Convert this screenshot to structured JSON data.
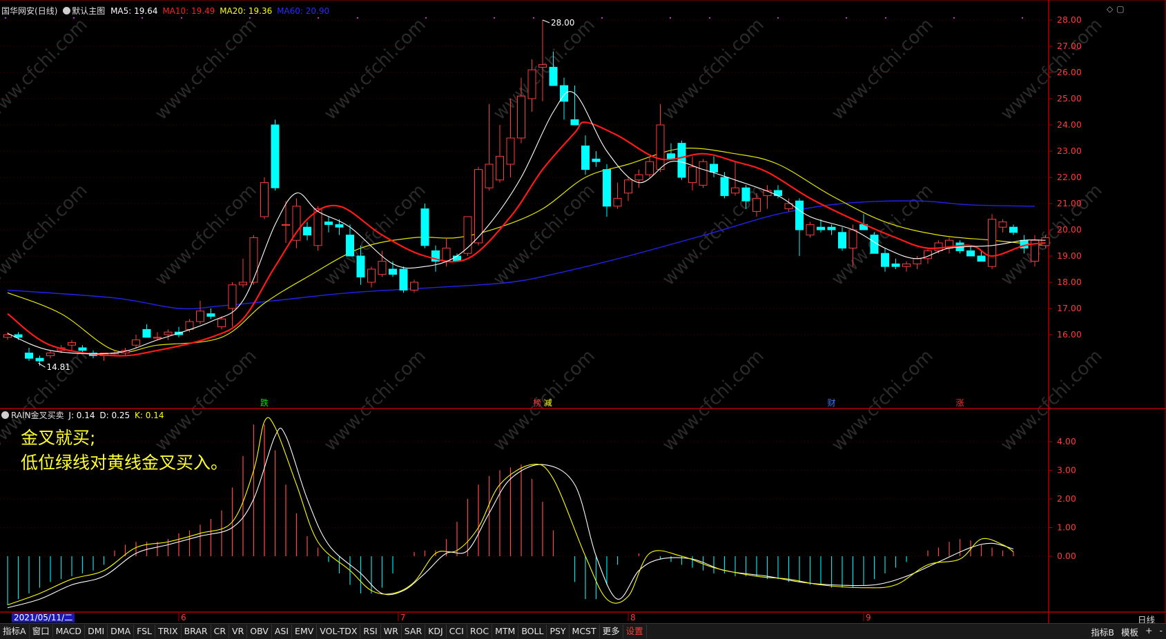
{
  "header": {
    "stock_name": "国华网安",
    "period": "(日线)",
    "main_chart_name": "默认主图",
    "ma5": "MA5: 19.64",
    "ma10": "MA10: 19.49",
    "ma20": "MA20: 19.36",
    "ma60": "MA60: 20.90"
  },
  "indicator_header": {
    "name": "RAIN金叉买卖",
    "j": "J: 0.14",
    "d": "D: 0.25",
    "k": "K: 0.14"
  },
  "annotation": {
    "line1": "金叉就买;",
    "line2": "低位绿线对黄线金叉买入。"
  },
  "price_axis": [
    "28.00",
    "27.00",
    "26.00",
    "25.00",
    "24.00",
    "23.00",
    "22.00",
    "21.00",
    "20.00",
    "19.00",
    "18.00",
    "17.00",
    "16.00"
  ],
  "indicator_axis": [
    "4.00",
    "3.00",
    "2.00",
    "1.00",
    "0.00"
  ],
  "markers": {
    "high": "28.00",
    "low": "14.81"
  },
  "event_labels": [
    {
      "text": "跌",
      "color": "#00e000"
    },
    {
      "text": "榜",
      "color": "#ff3030"
    },
    {
      "text": "减",
      "color": "#ffff00"
    },
    {
      "text": "财",
      "color": "#3a7aff"
    },
    {
      "text": "涨",
      "color": "#ff3030"
    }
  ],
  "time_axis": {
    "current_date": "2021/05/11/二",
    "months": [
      "6",
      "7",
      "8",
      "9"
    ],
    "period_label": "日线"
  },
  "colors": {
    "up": "#ff3c3c",
    "down": "#00ffff",
    "ma5": "#ffffff",
    "ma10": "#ff1a1a",
    "ma20": "#e6e600",
    "ma60": "#2222ee",
    "axis": "#b00000",
    "annotation": "#ffff2e"
  },
  "tabs": [
    "指标A",
    "窗口",
    "MACD",
    "DMI",
    "DMA",
    "FSL",
    "TRIX",
    "BRAR",
    "CR",
    "VR",
    "OBV",
    "ASI",
    "EMV",
    "VOL-TDX",
    "RSI",
    "WR",
    "SAR",
    "KDJ",
    "CCI",
    "ROC",
    "MTM",
    "BOLL",
    "PSY",
    "MCST",
    "更多",
    "设置"
  ],
  "tabs_active": "设置",
  "tabs_right": [
    "指标B",
    "模板",
    "+",
    "-"
  ],
  "watermark": "www.cfchi.com",
  "chart_data": {
    "type": "candlestick",
    "ylim": [
      15,
      28.5
    ],
    "candles_ohlc": [
      [
        15.9,
        16.1,
        15.8,
        16.0
      ],
      [
        16.0,
        16.1,
        15.8,
        15.9
      ],
      [
        15.3,
        15.5,
        15.0,
        15.1
      ],
      [
        15.1,
        15.2,
        14.81,
        15.0
      ],
      [
        15.2,
        15.4,
        15.1,
        15.3
      ],
      [
        15.4,
        15.6,
        15.3,
        15.5
      ],
      [
        15.6,
        15.8,
        15.4,
        15.7
      ],
      [
        15.5,
        15.6,
        15.3,
        15.4
      ],
      [
        15.3,
        15.4,
        15.1,
        15.2
      ],
      [
        15.2,
        15.3,
        15.0,
        15.3
      ],
      [
        15.3,
        15.4,
        15.2,
        15.3
      ],
      [
        15.3,
        15.5,
        15.2,
        15.4
      ],
      [
        15.6,
        16.0,
        15.5,
        15.8
      ],
      [
        16.2,
        16.4,
        16.0,
        15.9
      ],
      [
        15.9,
        16.1,
        15.8,
        15.9
      ],
      [
        16.0,
        16.2,
        15.8,
        16.1
      ],
      [
        16.1,
        16.3,
        15.9,
        16.0
      ],
      [
        16.2,
        16.6,
        16.1,
        16.5
      ],
      [
        16.5,
        17.3,
        16.4,
        16.9
      ],
      [
        16.8,
        17.0,
        16.6,
        16.7
      ],
      [
        16.3,
        16.7,
        16.2,
        16.6
      ],
      [
        17.0,
        18.0,
        16.3,
        17.9
      ],
      [
        17.9,
        18.9,
        17.8,
        18.0
      ],
      [
        18.0,
        19.8,
        17.9,
        19.7
      ],
      [
        20.5,
        22.0,
        20.4,
        21.8
      ],
      [
        24.0,
        24.2,
        21.5,
        21.6
      ],
      [
        20.2,
        21.1,
        19.5,
        20.2
      ],
      [
        19.6,
        21.2,
        19.3,
        20.9
      ],
      [
        20.1,
        20.3,
        19.6,
        19.8
      ],
      [
        19.4,
        20.9,
        19.2,
        20.8
      ],
      [
        20.3,
        20.5,
        19.9,
        20.2
      ],
      [
        20.2,
        20.4,
        19.8,
        20.1
      ],
      [
        19.8,
        20.2,
        19.0,
        19.0
      ],
      [
        19.0,
        19.4,
        17.9,
        18.2
      ],
      [
        18.0,
        18.6,
        17.8,
        18.5
      ],
      [
        18.3,
        19.2,
        18.2,
        18.8
      ],
      [
        18.5,
        18.8,
        18.2,
        18.3
      ],
      [
        18.5,
        18.6,
        17.6,
        17.7
      ],
      [
        17.7,
        18.1,
        17.6,
        18.0
      ],
      [
        20.8,
        21.0,
        19.3,
        19.4
      ],
      [
        19.2,
        19.4,
        18.4,
        18.8
      ],
      [
        18.8,
        19.7,
        18.6,
        19.3
      ],
      [
        19.0,
        19.1,
        18.8,
        18.8
      ],
      [
        19.1,
        20.2,
        19.0,
        20.5
      ],
      [
        19.5,
        22.4,
        19.4,
        22.3
      ],
      [
        21.6,
        24.8,
        21.5,
        22.5
      ],
      [
        21.9,
        24.0,
        21.8,
        22.8
      ],
      [
        22.5,
        25.0,
        22.0,
        23.5
      ],
      [
        23.5,
        25.8,
        23.3,
        25.1
      ],
      [
        25.0,
        26.5,
        24.5,
        26.1
      ],
      [
        26.2,
        28.0,
        24.9,
        26.3
      ],
      [
        26.2,
        26.8,
        25.5,
        25.5
      ],
      [
        25.5,
        25.8,
        24.2,
        24.9
      ],
      [
        24.2,
        25.5,
        24.0,
        24.0
      ],
      [
        23.2,
        23.6,
        22.1,
        22.3
      ],
      [
        22.7,
        23.0,
        22.4,
        22.6
      ],
      [
        22.3,
        22.5,
        20.5,
        20.9
      ],
      [
        20.9,
        21.8,
        20.8,
        21.2
      ],
      [
        21.4,
        22.0,
        21.1,
        21.9
      ],
      [
        21.9,
        22.3,
        21.6,
        22.1
      ],
      [
        22.1,
        22.8,
        22.0,
        22.6
      ],
      [
        22.3,
        24.8,
        22.2,
        24.0
      ],
      [
        22.9,
        23.3,
        22.7,
        22.7
      ],
      [
        23.3,
        23.4,
        21.9,
        22.0
      ],
      [
        21.8,
        22.8,
        21.5,
        22.4
      ],
      [
        21.7,
        22.7,
        21.6,
        22.6
      ],
      [
        22.5,
        22.8,
        22.0,
        22.2
      ],
      [
        22.0,
        22.2,
        21.2,
        21.3
      ],
      [
        21.4,
        22.6,
        21.3,
        21.6
      ],
      [
        21.6,
        21.7,
        20.8,
        21.1
      ],
      [
        20.7,
        21.4,
        20.5,
        21.2
      ],
      [
        21.3,
        21.7,
        20.8,
        21.5
      ],
      [
        21.5,
        21.7,
        21.2,
        21.3
      ],
      [
        20.8,
        21.2,
        20.7,
        21.0
      ],
      [
        21.1,
        21.2,
        19.0,
        20.0
      ],
      [
        19.8,
        20.3,
        19.7,
        20.2
      ],
      [
        20.1,
        20.4,
        19.9,
        20.0
      ],
      [
        20.1,
        20.2,
        19.8,
        20.0
      ],
      [
        19.9,
        20.1,
        19.2,
        19.3
      ],
      [
        19.3,
        20.2,
        18.6,
        20.0
      ],
      [
        20.2,
        20.6,
        20.0,
        20.0
      ],
      [
        19.8,
        19.9,
        19.1,
        19.1
      ],
      [
        19.1,
        19.3,
        18.4,
        18.6
      ],
      [
        18.7,
        18.9,
        18.5,
        18.6
      ],
      [
        18.6,
        18.8,
        18.4,
        18.7
      ],
      [
        18.7,
        19.0,
        18.5,
        18.9
      ],
      [
        18.9,
        19.3,
        18.7,
        19.2
      ],
      [
        19.2,
        19.6,
        19.1,
        19.5
      ],
      [
        19.3,
        19.7,
        19.1,
        19.6
      ],
      [
        19.5,
        19.6,
        19.1,
        19.2
      ],
      [
        19.2,
        19.4,
        19.0,
        19.0
      ],
      [
        19.0,
        19.2,
        18.8,
        18.8
      ],
      [
        18.6,
        20.6,
        18.5,
        20.4
      ],
      [
        20.1,
        20.4,
        19.9,
        20.3
      ],
      [
        20.1,
        20.2,
        19.8,
        19.9
      ],
      [
        19.6,
        19.8,
        19.1,
        19.3
      ],
      [
        18.8,
        19.8,
        18.6,
        19.6
      ],
      [
        19.4,
        19.8,
        19.3,
        19.7
      ]
    ],
    "ma5": [
      [
        0,
        16.05
      ],
      [
        4,
        15.4
      ],
      [
        10,
        15.3
      ],
      [
        14,
        15.8
      ],
      [
        19,
        16.5
      ],
      [
        22,
        17.3
      ],
      [
        25,
        20.2
      ],
      [
        27,
        21.4
      ],
      [
        29,
        20.7
      ],
      [
        32,
        20.1
      ],
      [
        36,
        18.7
      ],
      [
        39,
        18.6
      ],
      [
        42,
        19.0
      ],
      [
        45,
        20.2
      ],
      [
        48,
        22.0
      ],
      [
        51,
        24.5
      ],
      [
        53,
        25.2
      ],
      [
        56,
        23.0
      ],
      [
        59,
        21.8
      ],
      [
        62,
        22.6
      ],
      [
        65,
        22.3
      ],
      [
        68,
        21.9
      ],
      [
        72,
        21.3
      ],
      [
        75,
        20.5
      ],
      [
        79,
        20.0
      ],
      [
        82,
        19.3
      ],
      [
        85,
        18.9
      ],
      [
        88,
        19.3
      ],
      [
        92,
        19.4
      ],
      [
        95,
        19.6
      ],
      [
        97,
        19.6
      ]
    ],
    "ma10": [
      [
        0,
        16.8
      ],
      [
        4,
        15.6
      ],
      [
        10,
        15.2
      ],
      [
        14,
        15.4
      ],
      [
        19,
        15.9
      ],
      [
        22,
        16.6
      ],
      [
        25,
        18.6
      ],
      [
        28,
        20.4
      ],
      [
        31,
        20.9
      ],
      [
        35,
        19.8
      ],
      [
        39,
        19.0
      ],
      [
        43,
        18.9
      ],
      [
        47,
        20.5
      ],
      [
        50,
        22.3
      ],
      [
        53,
        23.7
      ],
      [
        54,
        24.1
      ],
      [
        57,
        23.6
      ],
      [
        61,
        22.7
      ],
      [
        65,
        22.9
      ],
      [
        68,
        22.6
      ],
      [
        71,
        22.2
      ],
      [
        75,
        21.2
      ],
      [
        79,
        20.4
      ],
      [
        83,
        19.7
      ],
      [
        86,
        19.3
      ],
      [
        90,
        19.4
      ],
      [
        92,
        19.0
      ],
      [
        95,
        19.4
      ],
      [
        97,
        19.5
      ]
    ],
    "ma20": [
      [
        0,
        17.6
      ],
      [
        5,
        16.8
      ],
      [
        10,
        15.4
      ],
      [
        14,
        15.6
      ],
      [
        20,
        15.9
      ],
      [
        24,
        17.2
      ],
      [
        28,
        18.2
      ],
      [
        33,
        19.3
      ],
      [
        38,
        19.7
      ],
      [
        42,
        19.7
      ],
      [
        46,
        20.1
      ],
      [
        50,
        20.8
      ],
      [
        54,
        22.0
      ],
      [
        58,
        22.5
      ],
      [
        63,
        23.1
      ],
      [
        68,
        22.9
      ],
      [
        72,
        22.5
      ],
      [
        77,
        21.3
      ],
      [
        82,
        20.3
      ],
      [
        87,
        19.8
      ],
      [
        92,
        19.6
      ],
      [
        97,
        19.4
      ]
    ],
    "ma60": [
      [
        0,
        17.7
      ],
      [
        10,
        17.4
      ],
      [
        16,
        17.0
      ],
      [
        20,
        17.1
      ],
      [
        25,
        17.3
      ],
      [
        32,
        17.6
      ],
      [
        40,
        17.8
      ],
      [
        47,
        18.0
      ],
      [
        52,
        18.4
      ],
      [
        58,
        19.0
      ],
      [
        66,
        19.9
      ],
      [
        72,
        20.6
      ],
      [
        78,
        21.0
      ],
      [
        85,
        21.1
      ],
      [
        90,
        20.95
      ],
      [
        96,
        20.9
      ]
    ],
    "kdj_k": [
      [
        0,
        -1.7
      ],
      [
        3,
        -1.3
      ],
      [
        6,
        -0.8
      ],
      [
        9,
        -0.5
      ],
      [
        12,
        0.3
      ],
      [
        15,
        0.5
      ],
      [
        18,
        0.8
      ],
      [
        21,
        1.2
      ],
      [
        23,
        3.0
      ],
      [
        24,
        4.7
      ],
      [
        25,
        4.5
      ],
      [
        27,
        2.5
      ],
      [
        29,
        0.5
      ],
      [
        32,
        -0.5
      ],
      [
        34,
        -1.2
      ],
      [
        36,
        -1.3
      ],
      [
        38,
        -0.9
      ],
      [
        40,
        0.1
      ],
      [
        42,
        0.2
      ],
      [
        44,
        1.0
      ],
      [
        46,
        2.5
      ],
      [
        49,
        3.2
      ],
      [
        51,
        2.7
      ],
      [
        54,
        0.0
      ],
      [
        56,
        -1.5
      ],
      [
        58,
        -1.4
      ],
      [
        60,
        0.1
      ],
      [
        63,
        0.0
      ],
      [
        66,
        -0.4
      ],
      [
        70,
        -0.7
      ],
      [
        73,
        -0.8
      ],
      [
        76,
        -1.0
      ],
      [
        80,
        -1.1
      ],
      [
        83,
        -1.0
      ],
      [
        86,
        -0.3
      ],
      [
        89,
        -0.1
      ],
      [
        91,
        0.6
      ],
      [
        93,
        0.4
      ],
      [
        94,
        0.15
      ]
    ],
    "kdj_d": [
      [
        0,
        -1.8
      ],
      [
        3,
        -1.5
      ],
      [
        6,
        -1.0
      ],
      [
        9,
        -0.7
      ],
      [
        12,
        0.1
      ],
      [
        15,
        0.4
      ],
      [
        18,
        0.7
      ],
      [
        21,
        1.0
      ],
      [
        23,
        2.0
      ],
      [
        25,
        4.2
      ],
      [
        26,
        4.2
      ],
      [
        28,
        2.0
      ],
      [
        30,
        0.4
      ],
      [
        33,
        -0.6
      ],
      [
        35,
        -1.3
      ],
      [
        37,
        -1.2
      ],
      [
        39,
        -0.6
      ],
      [
        41,
        0.1
      ],
      [
        43,
        0.2
      ],
      [
        45,
        1.5
      ],
      [
        47,
        2.7
      ],
      [
        50,
        3.2
      ],
      [
        53,
        2.5
      ],
      [
        55,
        0.0
      ],
      [
        57,
        -1.5
      ],
      [
        59,
        -0.5
      ],
      [
        61,
        -0.1
      ],
      [
        64,
        -0.1
      ],
      [
        67,
        -0.5
      ],
      [
        71,
        -0.7
      ],
      [
        74,
        -0.9
      ],
      [
        77,
        -1.0
      ],
      [
        81,
        -1.0
      ],
      [
        84,
        -0.7
      ],
      [
        87,
        -0.2
      ],
      [
        90,
        0.3
      ],
      [
        92,
        0.45
      ],
      [
        94,
        0.25
      ]
    ],
    "kdj_hist": [
      -1.7,
      -1.5,
      -1.3,
      -1.1,
      -0.9,
      -0.8,
      -0.7,
      -0.6,
      -0.5,
      -0.3,
      0.2,
      0.4,
      0.5,
      0.5,
      0.5,
      0.6,
      0.8,
      0.9,
      1.1,
      1.3,
      1.6,
      2.4,
      3.5,
      4.6,
      4.6,
      3.7,
      2.5,
      1.5,
      0.7,
      0.3,
      -0.2,
      -0.6,
      -1.0,
      -1.3,
      -1.3,
      -1.1,
      -0.6,
      0.0,
      0.15,
      0.2,
      0.2,
      0.6,
      1.2,
      2.0,
      2.5,
      2.8,
      3.0,
      3.1,
      3.2,
      2.7,
      1.9,
      0.9,
      0.0,
      -0.9,
      -1.5,
      -1.5,
      -1.0,
      -0.3,
      0.0,
      0.1,
      0.0,
      -0.1,
      -0.2,
      -0.3,
      -0.4,
      -0.5,
      -0.6,
      -0.6,
      -0.7,
      -0.7,
      -0.7,
      -0.8,
      -0.8,
      -0.9,
      -0.9,
      -1.0,
      -1.0,
      -1.1,
      -1.1,
      -1.1,
      -1.0,
      -0.8,
      -0.6,
      -0.4,
      -0.2,
      0.0,
      0.2,
      0.3,
      0.5,
      0.6,
      0.55,
      0.4,
      0.3,
      0.2,
      0.15
    ],
    "indicator_ylim": [
      -1.9,
      5.0
    ]
  }
}
